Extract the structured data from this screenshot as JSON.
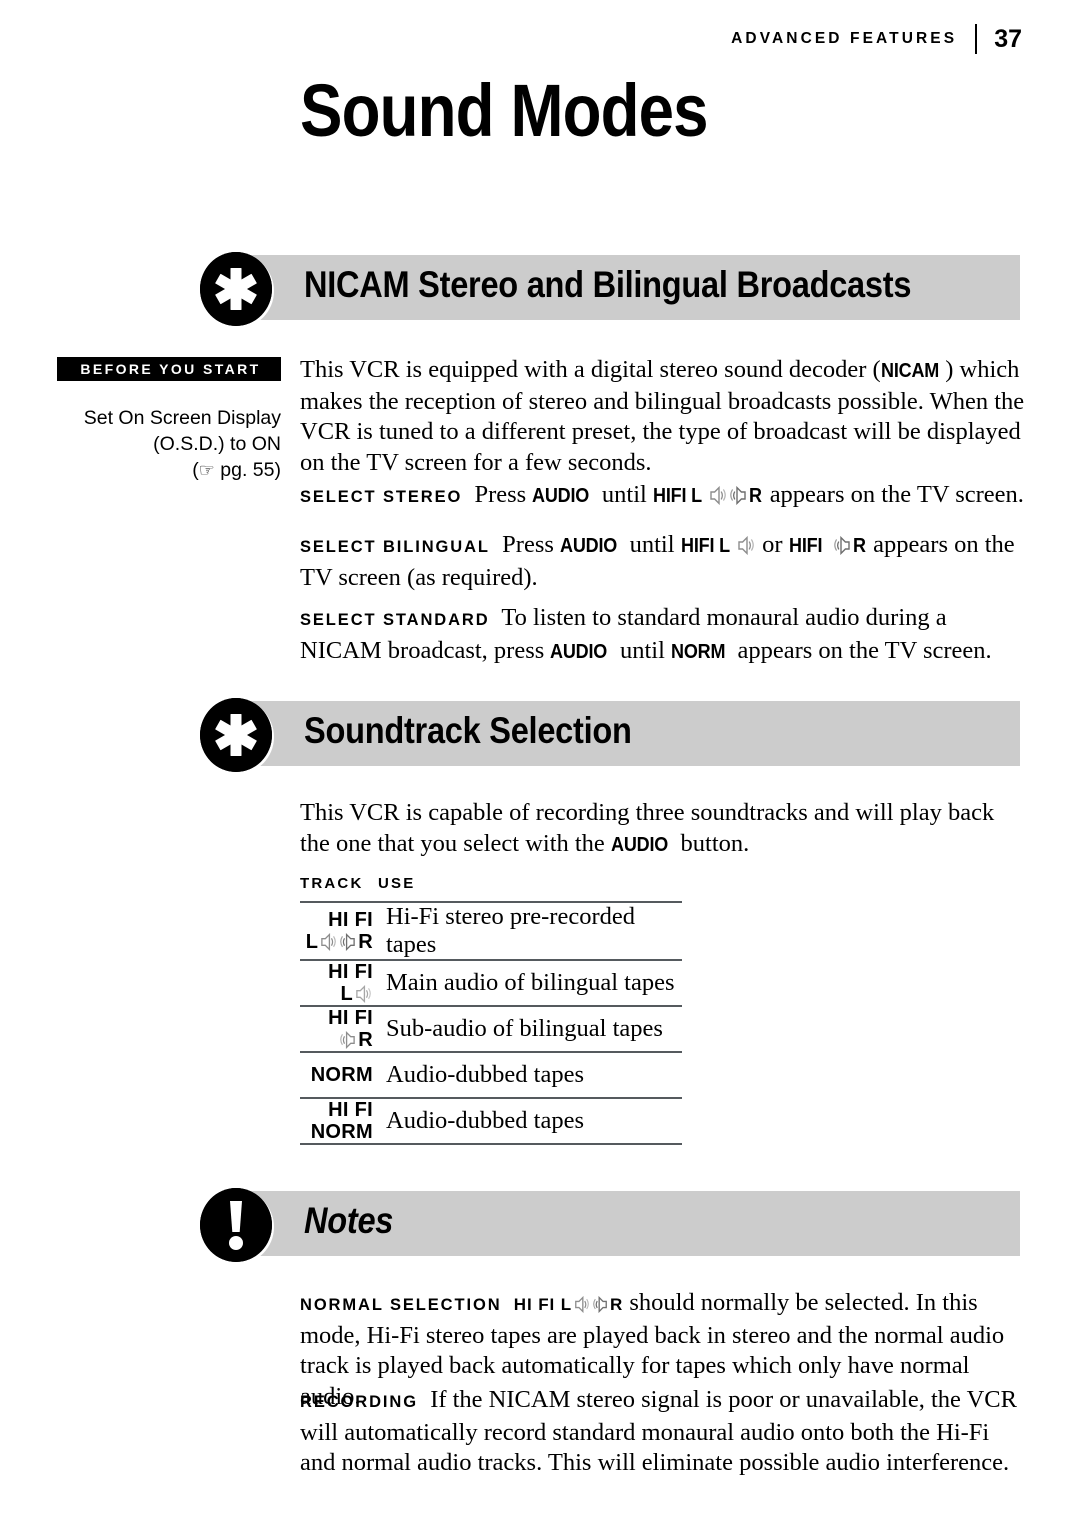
{
  "header": {
    "kicker": "ADVANCED FEATURES",
    "page_number": "37"
  },
  "title": "Sound Modes",
  "colors": {
    "banner_background": "#cccccc",
    "badge": "#000000",
    "rule": "#555a5e",
    "text": "#000000"
  },
  "sections": [
    {
      "badge_icon": "asterisk-icon",
      "heading": "NICAM Stereo and Bilingual Broadcasts"
    },
    {
      "badge_icon": "asterisk-icon",
      "heading": "Soundtrack Selection"
    },
    {
      "badge_icon": "exclamation-icon",
      "heading": "Notes"
    }
  ],
  "before_you_start": {
    "tag": "BEFORE YOU START",
    "line1": "Set On Screen Display",
    "line2": "(O.S.D.) to ON",
    "line3_open": "(",
    "line3_hand_icon": "pointing-hand-icon",
    "line3_hand_glyph": "☞",
    "line3_text": " pg. 55",
    "line3_close": ")"
  },
  "nicam": {
    "intro_a": "This VCR is equipped with a digital stereo sound decoder (",
    "intro_nicam": "NICAM",
    "intro_b": ") which makes the reception of stereo and bilingual broadcasts possible. When the VCR is tuned to a different preset, the type of broadcast will be displayed on the TV screen for a few seconds.",
    "stereo": {
      "label": "SELECT STEREO",
      "t1": "Press ",
      "audio": "AUDIO",
      "t2": " until ",
      "hifi": "HIFI L",
      "r": "R",
      "t3": " appears on the TV screen.",
      "speaker_left_icon": "speaker-right-facing-icon",
      "speaker_right_icon": "speaker-left-facing-icon"
    },
    "bilingual": {
      "label": "SELECT BILINGUAL",
      "t1": "Press ",
      "audio": "AUDIO",
      "t2": " until ",
      "hifi_l": "HIFI L",
      "t3": " or ",
      "hifi": "HIFI",
      "r": "R",
      "t4": " appears on the TV screen (as required)."
    },
    "standard": {
      "label": "SELECT STANDARD",
      "t1": "To listen to standard monaural audio during a NICAM broadcast, press ",
      "audio": "AUDIO",
      "t2": " until ",
      "norm": "NORM",
      "t3": " appears on the TV screen."
    }
  },
  "soundtrack": {
    "intro_a": "This VCR is capable of recording three soundtracks and will play back the one that you select with the ",
    "intro_audio": "AUDIO",
    "intro_b": " button.",
    "table": {
      "columns": [
        "TRACK",
        "USE"
      ],
      "rows": [
        {
          "track_line1": "HI FI",
          "track_line2_left": "L",
          "track_line2_right": "R",
          "speakers": "both",
          "use": "Hi-Fi stereo pre-recorded tapes"
        },
        {
          "track_line1": "HI FI",
          "track_line2_left": "L",
          "track_line2_right": "",
          "speakers": "left",
          "use": "Main audio of bilingual tapes"
        },
        {
          "track_line1": "HI FI",
          "track_line2_left": "",
          "track_line2_right": "R",
          "speakers": "right",
          "use": "Sub-audio of bilingual tapes"
        },
        {
          "track_line1": "",
          "track_line2_left": "",
          "track_line2_right": "",
          "speakers": "none",
          "track_single": "NORM",
          "use": "Audio-dubbed tapes"
        },
        {
          "track_line1": "HI FI",
          "track_line2_left": "",
          "track_line2_right": "",
          "speakers": "none",
          "track_line2_single": "NORM",
          "use": "Audio-dubbed tapes"
        }
      ]
    }
  },
  "notes": {
    "normal_selection": {
      "label": "NORMAL SELECTION",
      "hifi": "HI FI L",
      "r": "R",
      "text": " should normally be selected. In this mode, Hi-Fi stereo tapes are played back in stereo and the normal audio track is played back automatically for tapes which only have normal audio."
    },
    "recording": {
      "label": "RECORDING",
      "text": "If the NICAM stereo signal is poor or unavailable, the VCR will automatically record standard monaural audio onto both the Hi-Fi and normal audio tracks. This will eliminate possible audio interference."
    }
  }
}
